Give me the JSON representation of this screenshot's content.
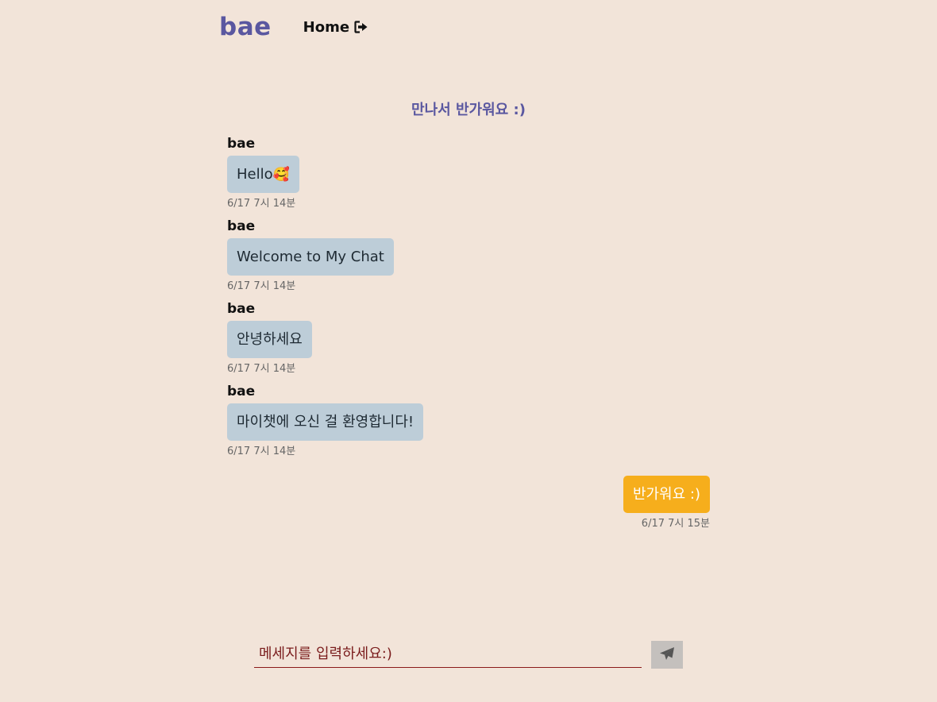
{
  "nav": {
    "logo": "bae",
    "home_label": "Home",
    "home_icon": "sign-out-icon"
  },
  "room": {
    "title": "만나서 반가워요 :)"
  },
  "messages": [
    {
      "sender": "bae",
      "text": "Hello",
      "emoji": "🥰",
      "time": "6/17 7시 14분",
      "mine": false
    },
    {
      "sender": "bae",
      "text": "Welcome to My Chat",
      "time": "6/17 7시 14분",
      "mine": false
    },
    {
      "sender": "bae",
      "text": "안녕하세요",
      "time": "6/17 7시 14분",
      "mine": false
    },
    {
      "sender": "bae",
      "text": "마이챗에 오신 걸 환영합니다!",
      "time": "6/17 7시 14분",
      "mine": false
    },
    {
      "text": "반가워요 :)",
      "time": "6/17 7시 15분",
      "mine": true
    }
  ],
  "composer": {
    "placeholder": "메세지를 입력하세요:)",
    "value": "",
    "send_icon": "paper-plane-icon"
  },
  "colors": {
    "background": "#f2e4d9",
    "brand": "#5a57a0",
    "other_bubble": "#bdcdd8",
    "my_bubble": "#f6ae1c",
    "input_underline": "#8b1a1a",
    "send_button": "#c4c0bd"
  }
}
